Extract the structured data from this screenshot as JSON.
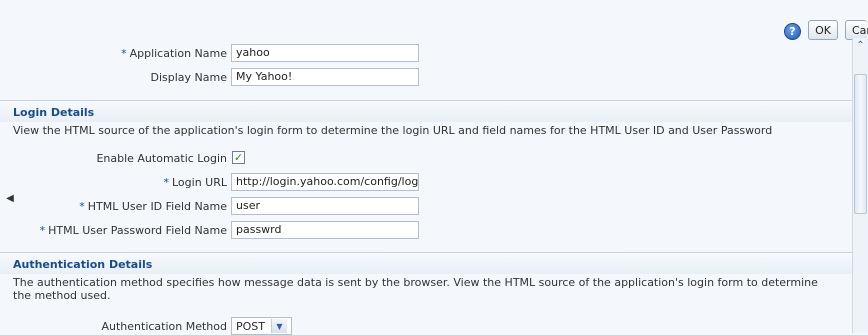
{
  "toolbar": {
    "help_icon": "question-icon",
    "help_glyph": "?",
    "ok_label": "OK",
    "cancel_label": "Cancel"
  },
  "app": {
    "application_name_label": "Application Name",
    "application_name_value": "yahoo",
    "display_name_label": "Display Name",
    "display_name_value": "My Yahoo!"
  },
  "login": {
    "title": "Login Details",
    "description": "View the HTML source of the application's login form to determine the login URL and field names for the HTML User ID and User Password",
    "enable_auto_login_label": "Enable Automatic Login",
    "enable_auto_login_checked": true,
    "check_glyph": "✓",
    "login_url_label": "Login URL",
    "login_url_value": "http://login.yahoo.com/config/login",
    "user_id_field_label": "HTML User ID Field Name",
    "user_id_field_value": "user",
    "password_field_label": "HTML User Password Field Name",
    "password_field_value": "passwrd"
  },
  "auth": {
    "title": "Authentication Details",
    "description": "The authentication method specifies how message data is sent by the browser. View the HTML source of the application's login form to determine the method used.",
    "method_label": "Authentication Method",
    "method_value": "POST"
  },
  "required_marker": "*",
  "scrollbar": {
    "up_glyph": "⌃"
  },
  "splitter_glyph": "◀",
  "colors": {
    "background": "#f4f8fc",
    "section_title": "#1a4c8a",
    "required": "#0055a8"
  }
}
